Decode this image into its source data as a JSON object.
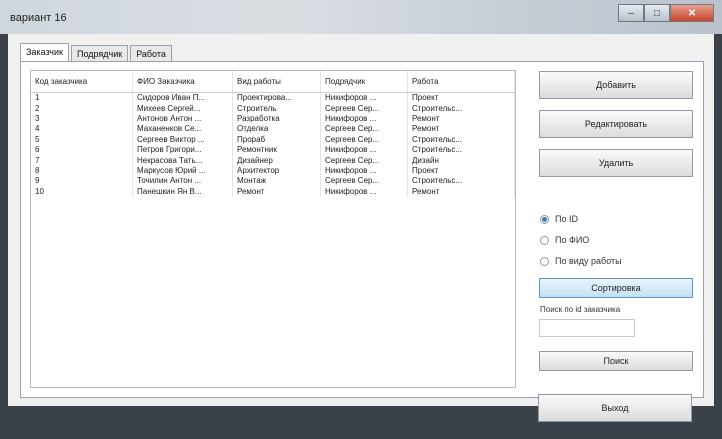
{
  "window": {
    "title": "вариант 16",
    "minimize": "–",
    "maximize": "□",
    "close": "✕"
  },
  "tabs": [
    {
      "label": "Заказчик"
    },
    {
      "label": "Подрядчик"
    },
    {
      "label": "Работа"
    }
  ],
  "table": {
    "headers": [
      "Код заказчика",
      "ФИО Заказчика",
      "Вид работы",
      "Подрядчик",
      "Работа"
    ],
    "rows": [
      [
        "1",
        "Сидоров Иван П...",
        "Проектирова...",
        "Никифоров ...",
        "Проект"
      ],
      [
        "2",
        "Михеев Сергей...",
        "Строитель",
        "Сергеев Сер...",
        "Строительс..."
      ],
      [
        "3",
        "Антонов Антон ...",
        "Разработка",
        "Никифоров ...",
        "Ремонт"
      ],
      [
        "4",
        "Маханенков Се...",
        "Отделка",
        "Сергеев Сер...",
        "Ремонт"
      ],
      [
        "5",
        "Сергеев Виктор ...",
        "Прораб",
        "Сергеев Сер...",
        "Строительс..."
      ],
      [
        "6",
        "Петров Григори...",
        "Ремонтник",
        "Никифоров ...",
        "Строительс..."
      ],
      [
        "7",
        "Некрасова Тать...",
        "Дизайнер",
        "Сергеев Сер...",
        "Дизайн"
      ],
      [
        "8",
        "Маркусов Юрий ...",
        "Архитектор",
        "Никифоров ...",
        "Проект"
      ],
      [
        "9",
        "Точилин Антон ...",
        "Монтаж",
        "Сергеев Сер...",
        "Строительс..."
      ],
      [
        "10",
        "Панешкин Ян В...",
        "Ремонт",
        "Никифоров ...",
        "Ремонт"
      ]
    ]
  },
  "buttons": {
    "add": "Добавить",
    "edit": "Редактировать",
    "delete": "Удалить",
    "sort": "Сортировка",
    "search": "Поиск",
    "exit": "Выход"
  },
  "sort_options": [
    {
      "label": "По ID",
      "selected": true
    },
    {
      "label": "По ФИО",
      "selected": false
    },
    {
      "label": "По виду работы",
      "selected": false
    }
  ],
  "search": {
    "label": "Поиск по id заказчика",
    "value": ""
  }
}
